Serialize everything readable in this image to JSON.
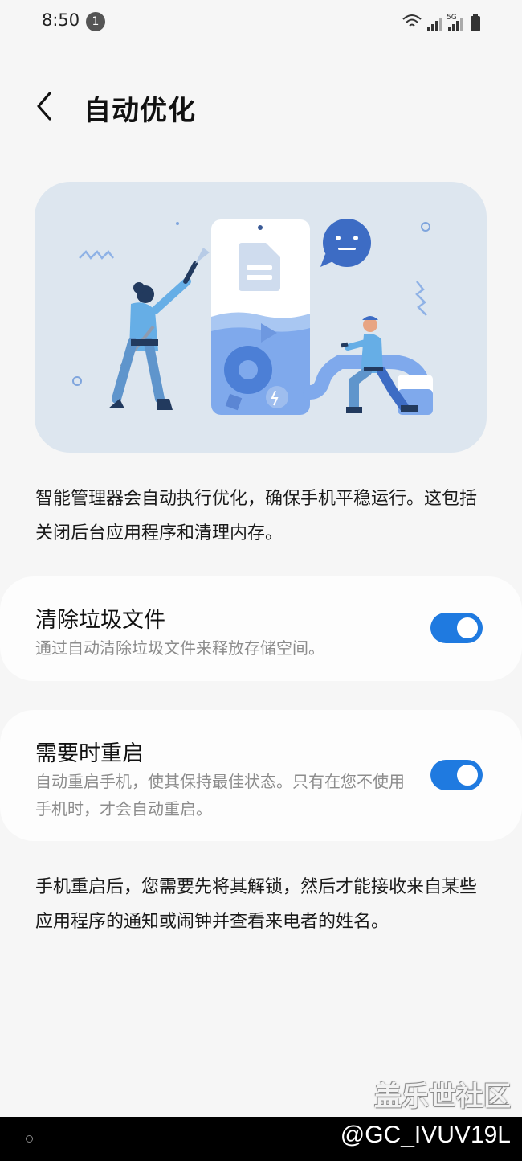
{
  "status_bar": {
    "time": "8:50",
    "notification_count": "1",
    "network_label": "5G"
  },
  "header": {
    "back_icon": "chevron-left-icon",
    "title": "自动优化"
  },
  "intro_text": "智能管理器会自动执行优化，确保手机平稳运行。这包括关闭后台应用程序和清理内存。",
  "settings": [
    {
      "title": "清除垃圾文件",
      "subtitle": "通过自动清除垃圾文件来释放存储空间。",
      "enabled": true
    },
    {
      "title": "需要时重启",
      "subtitle": "自动重启手机，使其保持最佳状态。只有在您不使用手机时，才会自动重启。",
      "enabled": true
    }
  ],
  "footer_note": "手机重启后，您需要先将其解锁，然后才能接收来自某些应用程序的通知或闹钟并查看来电者的姓名。",
  "watermarks": {
    "site": "盖乐世社区",
    "user": "@GC_IVUV19L"
  },
  "colors": {
    "accent": "#1f7ae0",
    "background": "#f6f6f6",
    "hero_bg": "#dde6ef"
  }
}
